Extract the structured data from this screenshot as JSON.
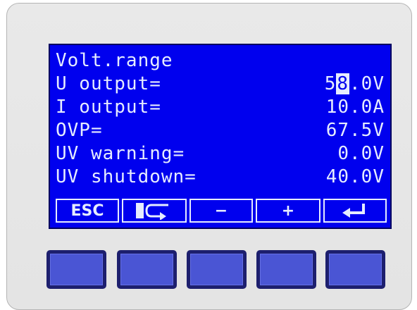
{
  "display": {
    "title": "Volt.range",
    "rows": [
      {
        "label": "U output=",
        "value_pre": "5",
        "value_cursor": "8",
        "value_post": ".0V"
      },
      {
        "label": "I output=",
        "value": "10.0A"
      },
      {
        "label": "OVP=",
        "value": "67.5V"
      },
      {
        "label": "UV warning=",
        "value": "0.0V"
      },
      {
        "label": "UV shutdown=",
        "value": "40.0V"
      }
    ]
  },
  "softkeys": {
    "esc": "ESC",
    "next_icon": "cursor-shift-icon",
    "minus": "−",
    "plus": "+",
    "enter_icon": "enter-arrow-icon"
  },
  "colors": {
    "lcd_background": "#0000ee",
    "lcd_text": "#e6ecff",
    "button_face": "#4a55d4",
    "button_border": "#1d1f6e"
  }
}
